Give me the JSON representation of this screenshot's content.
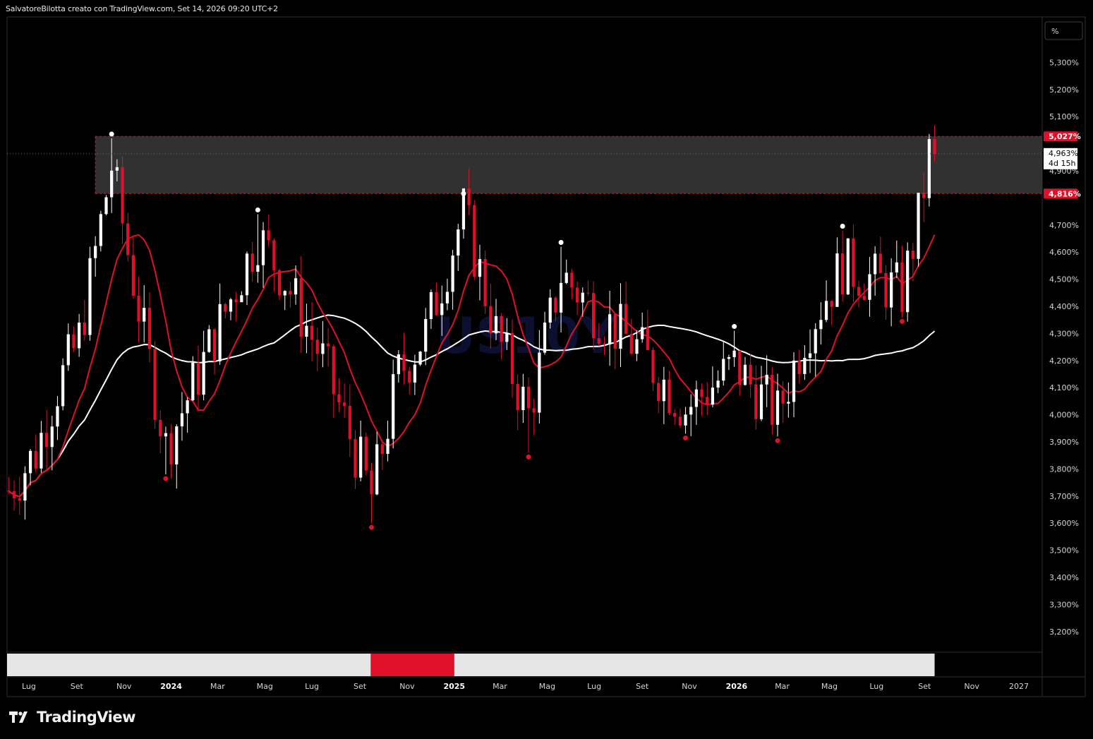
{
  "header": {
    "text": "SalvatoreBilotta creato con TradingView.com, Set 14, 2026 09:20 UTC+2"
  },
  "brand": {
    "name": "TradingView",
    "logo_icon": "tradingview-logo-icon"
  },
  "toolbar": {
    "scale_button_label": "%"
  },
  "colors": {
    "background": "#000000",
    "bullish_candle": "#ffffff",
    "bearish_candle": "#e0102a",
    "ma_fast": "#e0102a",
    "ma_slow": "#ffffff",
    "zone_fill": "#3a3a3a",
    "zone_border": "#e0102a",
    "axis_text": "#d1d4dc",
    "frame": "#2a2e39"
  },
  "price_axis": {
    "unit": "%",
    "ticks": [
      "5,300%",
      "5,200%",
      "5,100%",
      "4,900%",
      "4,700%",
      "4,600%",
      "4,500%",
      "4,400%",
      "4,300%",
      "4,200%",
      "4,100%",
      "4,000%",
      "3,900%",
      "3,800%",
      "3,700%",
      "3,600%",
      "3,500%",
      "3,400%",
      "3,300%",
      "3,200%"
    ],
    "resistance_top_label": "5,027%",
    "resistance_bottom_label": "4,816%",
    "last_price_label": "4,963%",
    "countdown_label": "4d 15h"
  },
  "time_axis": {
    "labels": [
      "Lug",
      "Set",
      "Nov",
      "2024",
      "Mar",
      "Mag",
      "Lug",
      "Set",
      "Nov",
      "2025",
      "Mar",
      "Mag",
      "Lug",
      "Set",
      "Nov",
      "2026",
      "Mar",
      "Mag",
      "Lug",
      "Set",
      "Nov",
      "2027"
    ],
    "bold_labels": [
      "2024",
      "2025",
      "2026"
    ]
  },
  "chart_data": {
    "type": "candlestick",
    "symbol": "US10Y",
    "timeframe": "weekly",
    "y_unit": "%",
    "y_range": [
      3.15,
      5.4
    ],
    "x_range": [
      "2023-06-01",
      "2027-02-01"
    ],
    "resistance_zone": {
      "low": 4.816,
      "high": 5.027,
      "start": "2023-09-25",
      "end": "open"
    },
    "last_price": 4.963,
    "moving_averages": [
      {
        "color": "red",
        "trend": "rising"
      },
      {
        "color": "white",
        "trend": "rising"
      }
    ],
    "swing_highs": [
      {
        "date": "2023-10-16",
        "value": 5.02
      },
      {
        "date": "2024-04-22",
        "value": 4.74
      },
      {
        "date": "2025-01-13",
        "value": 4.8
      },
      {
        "date": "2025-05-19",
        "value": 4.62
      },
      {
        "date": "2025-12-29",
        "value": 4.31
      },
      {
        "date": "2026-05-18",
        "value": 4.68
      }
    ],
    "swing_lows": [
      {
        "date": "2023-12-25",
        "value": 3.78
      },
      {
        "date": "2024-09-16",
        "value": 3.6
      },
      {
        "date": "2025-04-07",
        "value": 3.86
      },
      {
        "date": "2025-10-27",
        "value": 3.93
      },
      {
        "date": "2026-02-23",
        "value": 3.92
      },
      {
        "date": "2026-08-03",
        "value": 4.36
      }
    ],
    "trend_strip": [
      {
        "from": "2023-06-01",
        "to": "2024-09-15",
        "state": "neutral"
      },
      {
        "from": "2024-09-15",
        "to": "2025-01-01",
        "state": "bearish"
      },
      {
        "from": "2025-01-01",
        "to": "2026-09-14",
        "state": "neutral"
      }
    ]
  }
}
